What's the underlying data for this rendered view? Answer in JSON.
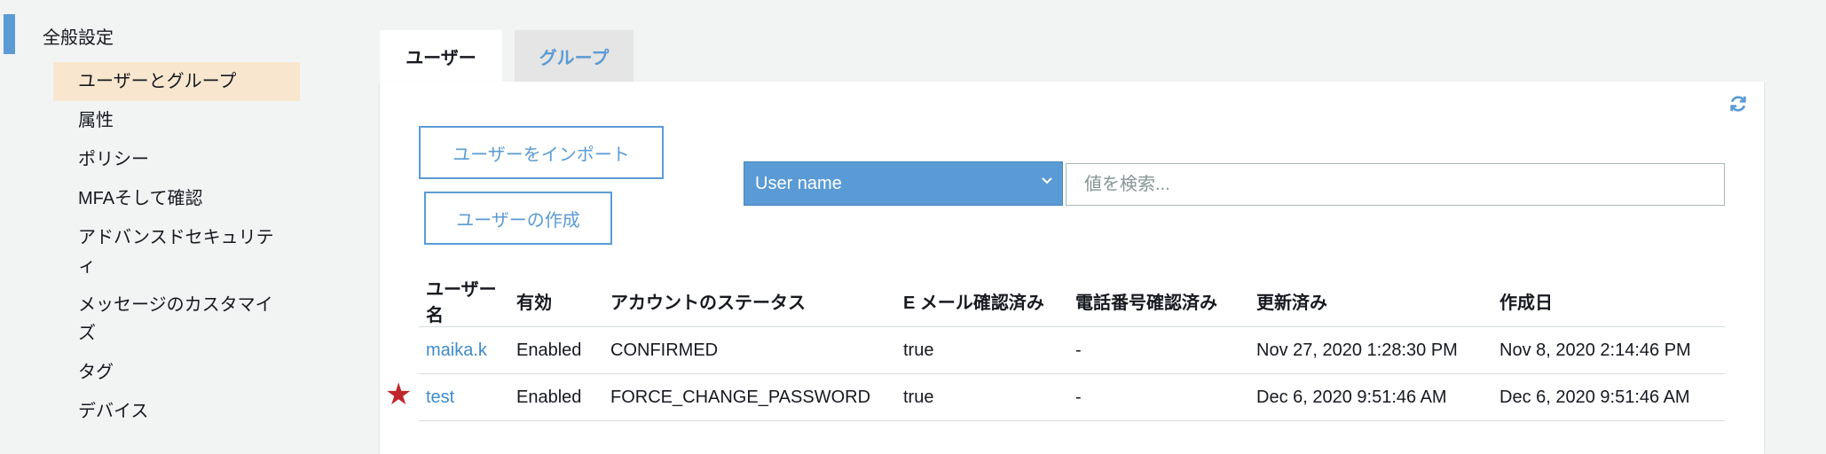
{
  "sidebar": {
    "section_title": "全般設定",
    "items": [
      {
        "label": "ユーザーとグループ",
        "active": true
      },
      {
        "label": "属性"
      },
      {
        "label": "ポリシー"
      },
      {
        "label": "MFAそして確認"
      },
      {
        "label": "アドバンスドセキュリティ"
      },
      {
        "label": "メッセージのカスタマイズ"
      },
      {
        "label": "タグ"
      },
      {
        "label": "デバイス"
      }
    ]
  },
  "tabs": [
    {
      "label": "ユーザー",
      "active": true
    },
    {
      "label": "グループ"
    }
  ],
  "toolbar": {
    "import_label": "ユーザーをインポート",
    "create_label": "ユーザーの作成"
  },
  "filter": {
    "attribute_selected": "User name",
    "search_placeholder": "値を検索..."
  },
  "table": {
    "headers": [
      "ユーザー名",
      "有効",
      "アカウントのステータス",
      "E メール確認済み",
      "電話番号確認済み",
      "更新済み",
      "作成日"
    ],
    "rows": [
      [
        "maika.k",
        "Enabled",
        "CONFIRMED",
        "true",
        "-",
        "Nov 27, 2020 1:28:30 PM",
        "Nov 8, 2020 2:14:46 PM"
      ],
      [
        "test",
        "Enabled",
        "FORCE_CHANGE_PASSWORD",
        "true",
        "-",
        "Dec 6, 2020 9:51:46 AM",
        "Dec 6, 2020 9:51:46 AM"
      ]
    ]
  },
  "marker": {
    "symbol": "★",
    "color": "#c0272d"
  },
  "colors": {
    "accent": "#5b9bd5",
    "active_nav_bg": "#f8e6cf",
    "link": "#3f8ccb"
  },
  "icons": {
    "refresh": "refresh-icon",
    "dropdown": "chevron-down-icon",
    "marker": "star-icon"
  }
}
